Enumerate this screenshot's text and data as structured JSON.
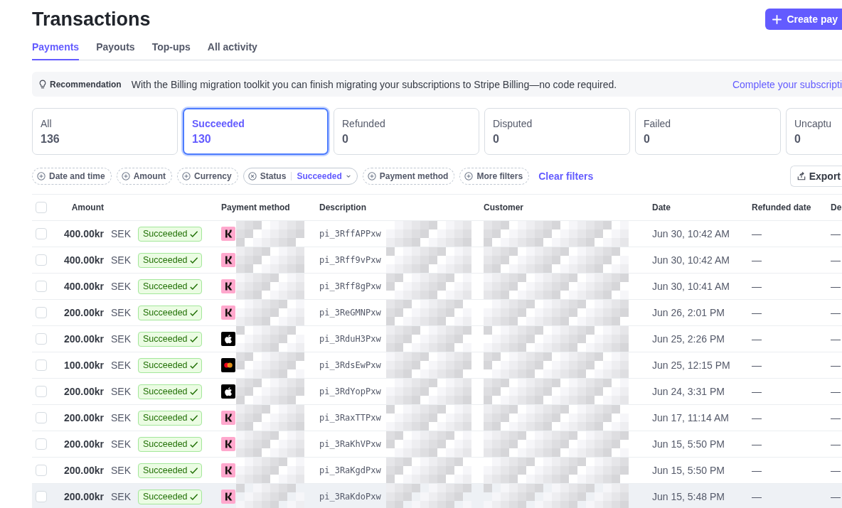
{
  "page": {
    "title": "Transactions",
    "primary_button": "Create pay"
  },
  "tabs": [
    {
      "label": "Payments",
      "selected": true
    },
    {
      "label": "Payouts",
      "selected": false
    },
    {
      "label": "Top-ups",
      "selected": false
    },
    {
      "label": "All activity",
      "selected": false
    }
  ],
  "recommendation": {
    "label": "Recommendation",
    "message": "With the Billing migration toolkit you can finish migrating your subscriptions to Stripe Billing—no code required.",
    "link": "Complete your subscripti"
  },
  "status_cards": [
    {
      "label": "All",
      "count": "136",
      "selected": false
    },
    {
      "label": "Succeeded",
      "count": "130",
      "selected": true
    },
    {
      "label": "Refunded",
      "count": "0",
      "selected": false
    },
    {
      "label": "Disputed",
      "count": "0",
      "selected": false
    },
    {
      "label": "Failed",
      "count": "0",
      "selected": false
    },
    {
      "label": "Uncaptu",
      "count": "0",
      "selected": false
    }
  ],
  "filters": [
    {
      "kind": "add",
      "label": "Date and time"
    },
    {
      "kind": "add",
      "label": "Amount"
    },
    {
      "kind": "add",
      "label": "Currency"
    },
    {
      "kind": "applied",
      "label": "Status",
      "value": "Succeeded"
    },
    {
      "kind": "add",
      "label": "Payment method"
    },
    {
      "kind": "add",
      "label": "More filters"
    }
  ],
  "clear_filters": "Clear filters",
  "export_button": "Export",
  "table": {
    "select_all": {
      "checked": false
    },
    "columns": [
      "Amount",
      "Payment method",
      "Description",
      "Customer",
      "Date",
      "Refunded date",
      "De"
    ],
    "rows": [
      {
        "amount": "400.00kr",
        "currency": "SEK",
        "status": "Succeeded",
        "payment_method": {
          "kind": "klarna"
        },
        "description": "pi_3RffAPPxw",
        "date": "Jun 30, 10:42 AM",
        "refunded_date": "—",
        "column_7": "—",
        "highlighted": false
      },
      {
        "amount": "400.00kr",
        "currency": "SEK",
        "status": "Succeeded",
        "payment_method": {
          "kind": "klarna"
        },
        "description": "pi_3Rff9vPxw",
        "date": "Jun 30, 10:42 AM",
        "refunded_date": "—",
        "column_7": "—",
        "highlighted": false
      },
      {
        "amount": "400.00kr",
        "currency": "SEK",
        "status": "Succeeded",
        "payment_method": {
          "kind": "klarna"
        },
        "description": "pi_3Rff8gPxw",
        "date": "Jun 30, 10:41 AM",
        "refunded_date": "—",
        "column_7": "—",
        "highlighted": false
      },
      {
        "amount": "200.00kr",
        "currency": "SEK",
        "status": "Succeeded",
        "payment_method": {
          "kind": "klarna"
        },
        "description": "pi_3ReGMNPxw",
        "date": "Jun 26, 2:01 PM",
        "refunded_date": "—",
        "column_7": "—",
        "highlighted": false
      },
      {
        "amount": "200.00kr",
        "currency": "SEK",
        "status": "Succeeded",
        "payment_method": {
          "kind": "apple_pay"
        },
        "description": "pi_3RduH3Pxw",
        "date": "Jun 25, 2:26 PM",
        "refunded_date": "—",
        "column_7": "—",
        "highlighted": false
      },
      {
        "amount": "100.00kr",
        "currency": "SEK",
        "status": "Succeeded",
        "payment_method": {
          "kind": "card"
        },
        "description": "pi_3RdsEwPxw",
        "date": "Jun 25, 12:15 PM",
        "refunded_date": "—",
        "column_7": "—",
        "highlighted": false
      },
      {
        "amount": "200.00kr",
        "currency": "SEK",
        "status": "Succeeded",
        "payment_method": {
          "kind": "apple_pay"
        },
        "description": "pi_3RdYopPxw",
        "date": "Jun 24, 3:31 PM",
        "refunded_date": "—",
        "column_7": "—",
        "highlighted": false
      },
      {
        "amount": "200.00kr",
        "currency": "SEK",
        "status": "Succeeded",
        "payment_method": {
          "kind": "klarna"
        },
        "description": "pi_3RaxTTPxw",
        "date": "Jun 17, 11:14 AM",
        "refunded_date": "—",
        "column_7": "—",
        "highlighted": false
      },
      {
        "amount": "200.00kr",
        "currency": "SEK",
        "status": "Succeeded",
        "payment_method": {
          "kind": "klarna"
        },
        "description": "pi_3RaKhVPxw",
        "date": "Jun 15, 5:50 PM",
        "refunded_date": "—",
        "column_7": "—",
        "highlighted": false
      },
      {
        "amount": "200.00kr",
        "currency": "SEK",
        "status": "Succeeded",
        "payment_method": {
          "kind": "klarna"
        },
        "description": "pi_3RaKgdPxw",
        "date": "Jun 15, 5:50 PM",
        "refunded_date": "—",
        "column_7": "—",
        "highlighted": false
      },
      {
        "amount": "200.00kr",
        "currency": "SEK",
        "status": "Succeeded",
        "payment_method": {
          "kind": "klarna"
        },
        "description": "pi_3RaKdoPxw",
        "date": "Jun 15, 5:48 PM",
        "refunded_date": "—",
        "column_7": "—",
        "highlighted": true
      }
    ]
  }
}
